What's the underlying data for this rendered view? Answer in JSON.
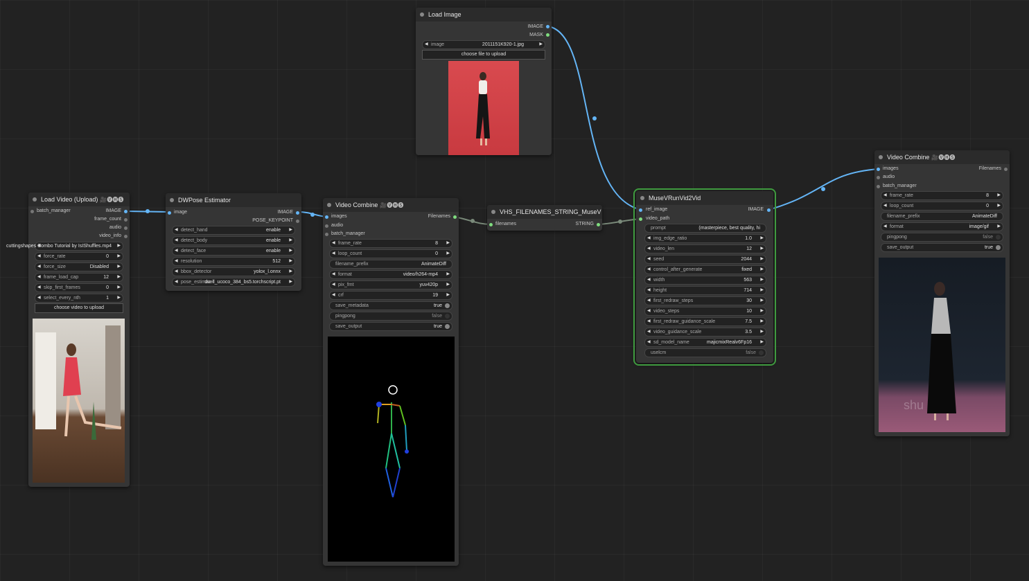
{
  "nodes": {
    "load_image": {
      "title": "Load Image",
      "outputs": [
        "IMAGE",
        "MASK"
      ],
      "image_widget": {
        "label": "image",
        "value": "2011151K920-1.jpg"
      },
      "upload_label": "choose file to upload"
    },
    "load_video": {
      "title": "Load Video (Upload)",
      "badge": "🎥🅥🅗🅢",
      "input": "batch_manager",
      "outputs": [
        "IMAGE",
        "frame_count",
        "audio",
        "video_info"
      ],
      "video_value": "cuttingshapes Combo Tutorial by IsIShuffles.mp4",
      "widgets": [
        {
          "label": "force_rate",
          "value": "0"
        },
        {
          "label": "force_size",
          "value": "Disabled"
        },
        {
          "label": "frame_load_cap",
          "value": "12"
        },
        {
          "label": "skip_first_frames",
          "value": "0"
        },
        {
          "label": "select_every_nth",
          "value": "1"
        }
      ],
      "upload_label": "choose video to upload"
    },
    "dwpose": {
      "title": "DWPose Estimator",
      "input": "image",
      "outputs": [
        "IMAGE",
        "POSE_KEYPOINT"
      ],
      "widgets": [
        {
          "label": "detect_hand",
          "value": "enable"
        },
        {
          "label": "detect_body",
          "value": "enable"
        },
        {
          "label": "detect_face",
          "value": "enable"
        },
        {
          "label": "resolution",
          "value": "512"
        },
        {
          "label": "bbox_detector",
          "value": "yolox_l.onnx"
        },
        {
          "label": "pose_estimator",
          "value": "dw-ll_ucoco_384_bs5.torchscript.pt"
        }
      ]
    },
    "video_combine_1": {
      "title": "Video Combine",
      "badge": "🎥🅥🅗🅢",
      "inputs": [
        "images",
        "audio",
        "batch_manager"
      ],
      "output": "Filenames",
      "widgets": [
        {
          "label": "frame_rate",
          "value": "8",
          "type": "number"
        },
        {
          "label": "loop_count",
          "value": "0",
          "type": "number"
        },
        {
          "label": "filename_prefix",
          "value": "AnimateDiff",
          "type": "text"
        },
        {
          "label": "format",
          "value": "video/h264-mp4",
          "type": "combo"
        },
        {
          "label": "pix_fmt",
          "value": "yuv420p",
          "type": "combo"
        },
        {
          "label": "crf",
          "value": "19",
          "type": "number"
        },
        {
          "label": "save_metadata",
          "value": "true",
          "type": "toggle",
          "on": true
        },
        {
          "label": "pingpong",
          "value": "false",
          "type": "toggle",
          "on": false
        },
        {
          "label": "save_output",
          "value": "true",
          "type": "toggle",
          "on": true
        }
      ]
    },
    "vhs_filenames": {
      "title": "VHS_FILENAMES_STRING_MuseV",
      "input": "filenames",
      "output": "STRING"
    },
    "musev": {
      "title": "MuseVRunVid2Vid",
      "inputs": [
        "ref_image",
        "video_path"
      ],
      "output": "IMAGE",
      "widgets": [
        {
          "label": "prompt",
          "value": "(masterpiece, best quality, hi",
          "type": "text"
        },
        {
          "label": "img_edge_ratio",
          "value": "1.0",
          "type": "number"
        },
        {
          "label": "video_len",
          "value": "12",
          "type": "number"
        },
        {
          "label": "seed",
          "value": "2044",
          "type": "number"
        },
        {
          "label": "control_after_generate",
          "value": "fixed",
          "type": "combo"
        },
        {
          "label": "width",
          "value": "563",
          "type": "number"
        },
        {
          "label": "height",
          "value": "714",
          "type": "number"
        },
        {
          "label": "first_redraw_steps",
          "value": "30",
          "type": "number"
        },
        {
          "label": "video_steps",
          "value": "10",
          "type": "number"
        },
        {
          "label": "first_redraw_guidance_scale",
          "value": "7.5",
          "type": "number"
        },
        {
          "label": "video_guidance_scale",
          "value": "3.5",
          "type": "number"
        },
        {
          "label": "sd_model_name",
          "value": "majicmixRealv6Fp16",
          "type": "combo"
        },
        {
          "label": "uselcm",
          "value": "false",
          "type": "toggle",
          "on": false
        }
      ]
    },
    "video_combine_2": {
      "title": "Video Combine",
      "badge": "🎥🅥🅗🅢",
      "inputs": [
        "images",
        "audio",
        "batch_manager"
      ],
      "output": "Filenames",
      "widgets": [
        {
          "label": "frame_rate",
          "value": "8",
          "type": "number"
        },
        {
          "label": "loop_count",
          "value": "0",
          "type": "number"
        },
        {
          "label": "filename_prefix",
          "value": "AnimateDiff",
          "type": "text"
        },
        {
          "label": "format",
          "value": "image/gif",
          "type": "combo"
        },
        {
          "label": "pingpong",
          "value": "false",
          "type": "toggle",
          "on": false
        },
        {
          "label": "save_output",
          "value": "true",
          "type": "toggle",
          "on": true
        }
      ],
      "watermark": "shu"
    }
  },
  "colors": {
    "canvas": "#222222",
    "node_bg": "#353535",
    "image_wire": "#64b5f6",
    "string_wire": "#7a8a7a",
    "active_outline": "#3f9b3f",
    "string_socket": "#7fdc7f"
  }
}
